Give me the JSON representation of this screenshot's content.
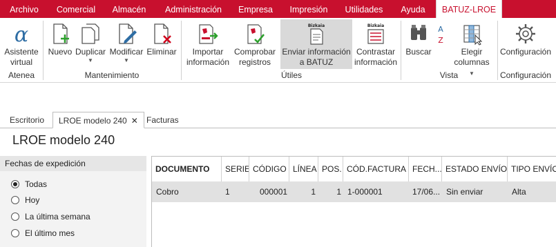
{
  "menubar": {
    "tabs": [
      "Archivo",
      "Comercial",
      "Almacén",
      "Administración",
      "Empresa",
      "Impresión",
      "Utilidades",
      "Ayuda",
      "BATUZ-LROE"
    ],
    "active": "BATUZ-LROE",
    "accent": "#c8102e"
  },
  "ribbon": {
    "atenea": {
      "button": "Asistente virtual",
      "group": "Atenea"
    },
    "mantenimiento": {
      "group": "Mantenimiento",
      "nuevo": "Nuevo",
      "duplicar": "Duplicar",
      "modificar": "Modificar",
      "eliminar": "Eliminar"
    },
    "utiles": {
      "group": "Útiles",
      "importar": "Importar información",
      "comprobar": "Comprobar registros",
      "enviar": "Enviar información a BATUZ",
      "contrastar": "Contrastar información"
    },
    "vista": {
      "group": "Vista",
      "buscar": "Buscar",
      "elegir": "Elegir columnas"
    },
    "configuracion": {
      "button": "Configuración",
      "group": "Configuración"
    }
  },
  "doc_tabs": [
    "Escritorio",
    "LROE modelo 240",
    "Facturas"
  ],
  "page_title": "LROE modelo 240",
  "filter": {
    "title": "Fechas de expedición",
    "options": [
      "Todas",
      "Hoy",
      "La última semana",
      "El último mes"
    ],
    "selected": "Todas"
  },
  "grid": {
    "columns": [
      "DOCUMENTO",
      "SERIE",
      "CÓDIGO",
      "LÍNEA",
      "POS.",
      "CÓD.FACTURA",
      "FECH...",
      "ESTADO ENVÍO",
      "TIPO ENVÍO"
    ],
    "rows": [
      [
        "Cobro",
        "1",
        "000001",
        "1",
        "1",
        "1-000001",
        "17/06...",
        "Sin enviar",
        "Alta"
      ]
    ]
  }
}
